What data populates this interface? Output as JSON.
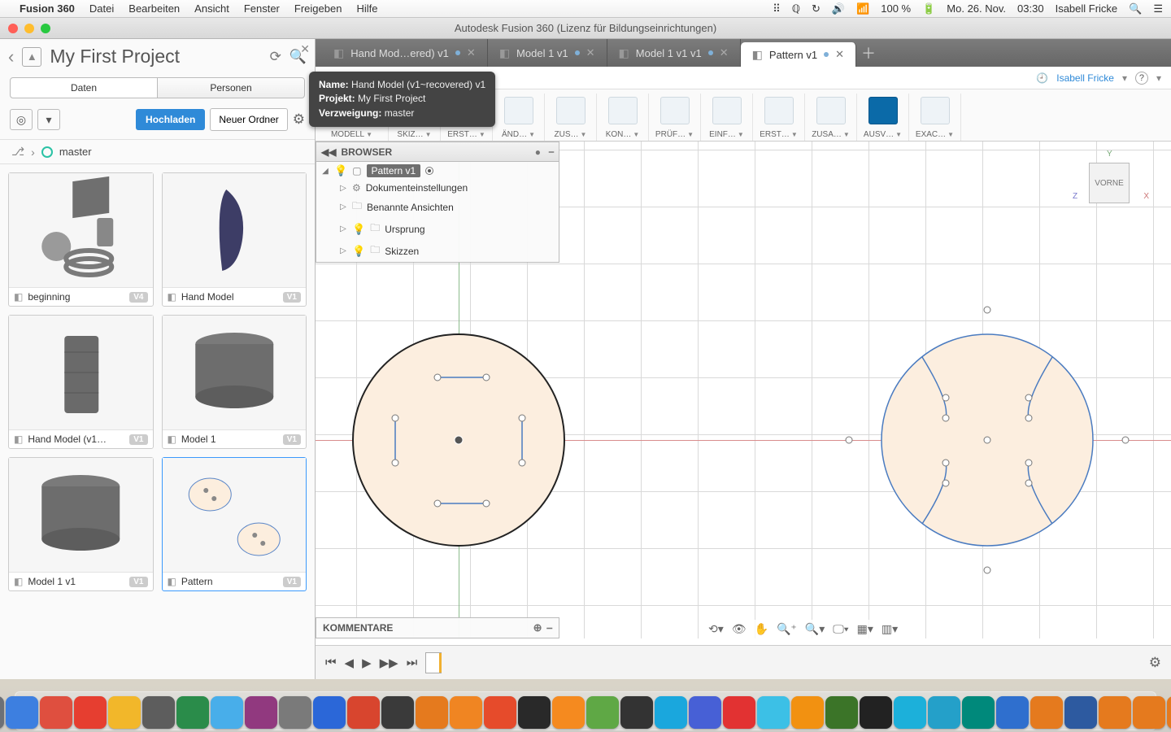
{
  "menubar": {
    "app": "Fusion 360",
    "items": [
      "Datei",
      "Bearbeiten",
      "Ansicht",
      "Fenster",
      "Freigeben",
      "Hilfe"
    ],
    "battery": "100 %",
    "date": "Mo. 26. Nov.",
    "time": "03:30",
    "user": "Isabell Fricke"
  },
  "window": {
    "title": "Autodesk Fusion 360 (Lizenz für Bildungseinrichtungen)"
  },
  "datapanel": {
    "title": "My First Project",
    "tabs": {
      "data": "Daten",
      "people": "Personen"
    },
    "upload": "Hochladen",
    "newfolder": "Neuer Ordner",
    "branch": "master",
    "cards": [
      {
        "name": "beginning",
        "ver": "V4"
      },
      {
        "name": "Hand Model",
        "ver": "V1"
      },
      {
        "name": "Hand Model (v1…",
        "ver": "V1"
      },
      {
        "name": "Model 1",
        "ver": "V1"
      },
      {
        "name": "Model 1 v1",
        "ver": "V1"
      },
      {
        "name": "Pattern",
        "ver": "V1"
      }
    ]
  },
  "tabs": [
    {
      "label": "Hand Mod…ered) v1",
      "active": false
    },
    {
      "label": "Model 1 v1",
      "active": false
    },
    {
      "label": "Model 1 v1 v1",
      "active": false
    },
    {
      "label": "Pattern v1",
      "active": true
    }
  ],
  "userrow": {
    "name": "Isabell Fricke"
  },
  "toolbar": {
    "model": "MODELL",
    "groups": [
      "SKIZ…",
      "ERST…",
      "ÄND…",
      "ZUS…",
      "KON…",
      "PRÜF…",
      "EINF…",
      "ERST…",
      "ZUSA…",
      "AUSV…",
      "EXAC…"
    ]
  },
  "browser": {
    "title": "BROWSER",
    "root": "Pattern v1",
    "items": [
      "Dokumenteinstellungen",
      "Benannte Ansichten",
      "Ursprung",
      "Skizzen"
    ]
  },
  "comments": {
    "title": "KOMMENTARE"
  },
  "viewcube": {
    "face": "VORNE"
  },
  "tooltip": {
    "l1a": "Name:",
    "l1b": "Hand Model (v1~recovered) v1",
    "l2a": "Projekt:",
    "l2b": "My First Project",
    "l3a": "Verzweigung:",
    "l3b": "master"
  },
  "dock": {
    "colors": [
      "#2f6fce",
      "#6c7076",
      "#3d7fe0",
      "#df4f3f",
      "#e63e30",
      "#f2b72a",
      "#5d5d5d",
      "#2a8c4a",
      "#48aeea",
      "#91397f",
      "#7a7a7a",
      "#2b67d8",
      "#d8452e",
      "#3a3a3a",
      "#e57a1e",
      "#f08522",
      "#e64b2b",
      "#292929",
      "#f58a1f",
      "#5fa845",
      "#333333",
      "#1aa7dd",
      "#4760d6",
      "#e23232",
      "#3cc0e6",
      "#f29111",
      "#3b7428",
      "#222222",
      "#1cb0da",
      "#24a0c9",
      "#00897b",
      "#2f6fce",
      "#e57a1e",
      "#2d5aa0",
      "#e57a1e",
      "#e57a1e",
      "#e57a1e",
      "#545454"
    ]
  }
}
